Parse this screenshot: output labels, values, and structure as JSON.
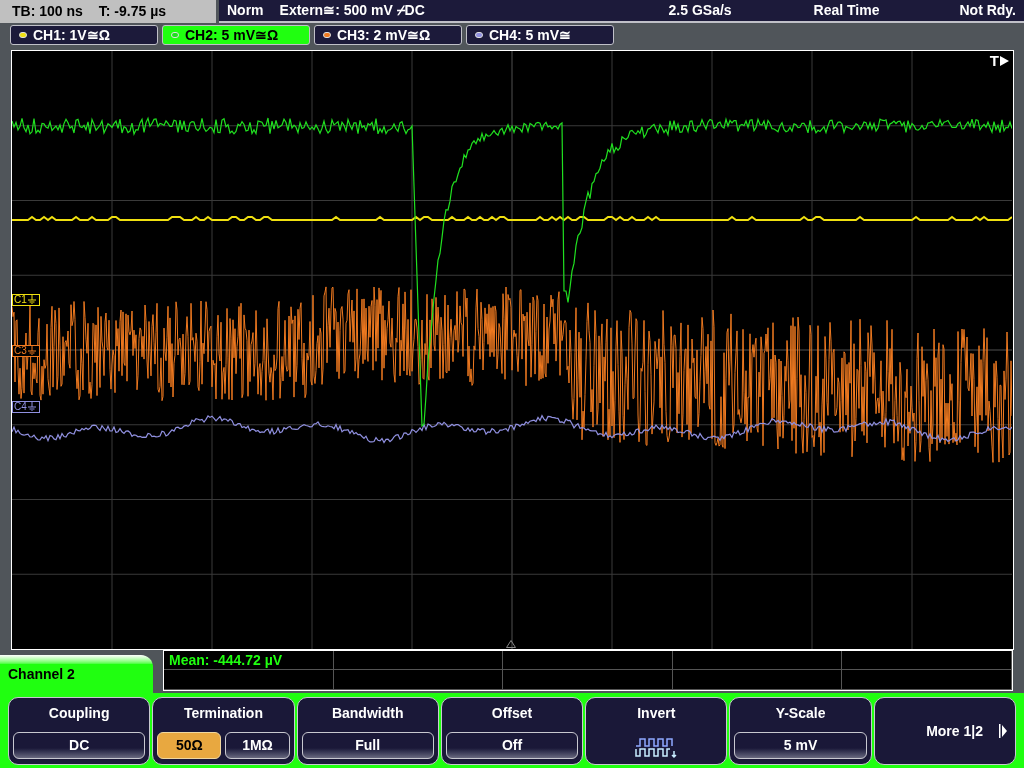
{
  "status_bar": {
    "timebase": "TB: 100 ns",
    "trigger_time": "T: -9.75 µs",
    "mode": "Norm",
    "trigger_source": "Extern≅: 500 mV ⌿DC",
    "sample_rate": "2.5 GSa/s",
    "acquisition": "Real Time",
    "state": "Not Rdy."
  },
  "channels": [
    {
      "label": "CH1: 1V≅Ω",
      "color": "#f0e010",
      "selected": false
    },
    {
      "label": "CH2: 5 mV≅Ω",
      "color": "#20e020",
      "selected": true
    },
    {
      "label": "CH3: 2 mV≅Ω",
      "color": "#f07a20",
      "selected": false
    },
    {
      "label": "CH4: 5 mV≅",
      "color": "#9090e0",
      "selected": false
    }
  ],
  "plot": {
    "trigger_label": "T",
    "channel_markers": [
      {
        "label": "C1",
        "color": "#f0e010"
      },
      {
        "label": "C3",
        "color": "#f07a20"
      },
      {
        "label": "C4",
        "color": "#9090e0"
      }
    ]
  },
  "measurement": {
    "text": "Mean: -444.72 µV"
  },
  "menu": {
    "title": "Channel 2",
    "softkeys": [
      {
        "kind": "select",
        "title": "Coupling",
        "value": "DC"
      },
      {
        "kind": "toggle",
        "title": "Termination",
        "options": [
          {
            "label": "50Ω",
            "selected": true
          },
          {
            "label": "1MΩ",
            "selected": false
          }
        ]
      },
      {
        "kind": "select",
        "title": "Bandwidth",
        "value": "Full"
      },
      {
        "kind": "select",
        "title": "Offset",
        "value": "Off"
      },
      {
        "kind": "icon",
        "title": "Invert"
      },
      {
        "kind": "select",
        "title": "Y-Scale",
        "value": "5 mV"
      },
      {
        "kind": "more",
        "title": "More 1|2"
      }
    ]
  }
}
